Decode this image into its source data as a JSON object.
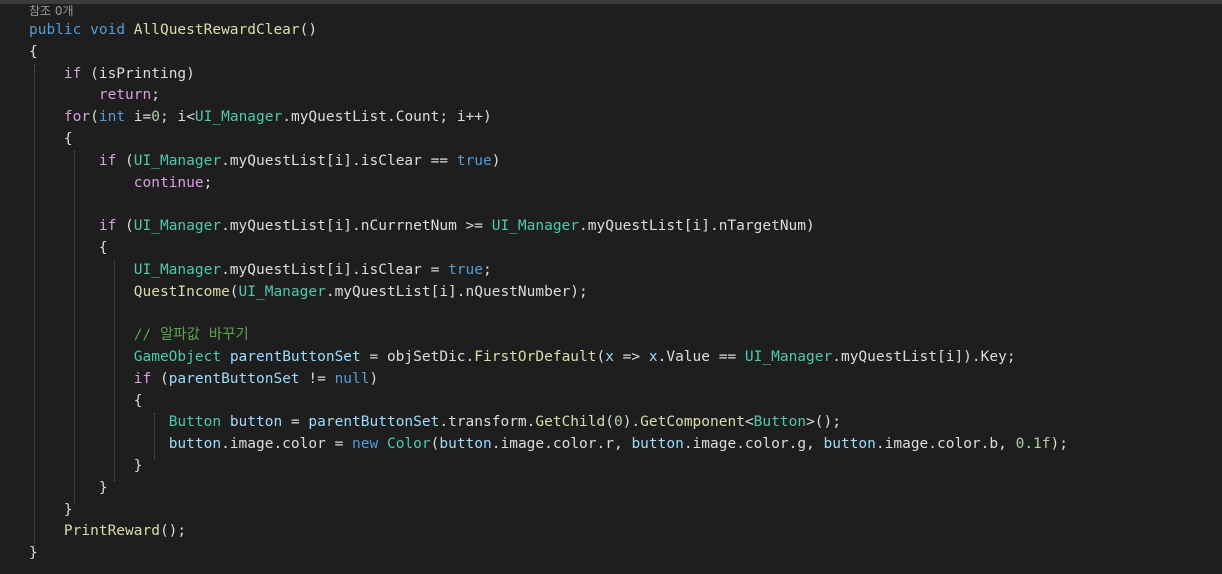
{
  "codelens": {
    "references": "참조 0개"
  },
  "code_lines": [
    [
      {
        "t": "public",
        "c": "kw"
      },
      {
        "t": " ",
        "c": "id"
      },
      {
        "t": "void",
        "c": "kw"
      },
      {
        "t": " ",
        "c": "id"
      },
      {
        "t": "AllQuestRewardClear",
        "c": "fn"
      },
      {
        "t": "()",
        "c": "id"
      }
    ],
    [
      {
        "t": "{",
        "c": "id"
      }
    ],
    [
      {
        "t": "    ",
        "c": "id"
      },
      {
        "t": "if",
        "c": "ctl"
      },
      {
        "t": " (isPrinting)",
        "c": "id"
      }
    ],
    [
      {
        "t": "        ",
        "c": "id"
      },
      {
        "t": "return",
        "c": "ctl"
      },
      {
        "t": ";",
        "c": "id"
      }
    ],
    [
      {
        "t": "    ",
        "c": "id"
      },
      {
        "t": "for",
        "c": "ctl"
      },
      {
        "t": "(",
        "c": "id"
      },
      {
        "t": "int",
        "c": "kw"
      },
      {
        "t": " i=",
        "c": "id"
      },
      {
        "t": "0",
        "c": "num"
      },
      {
        "t": "; i<",
        "c": "id"
      },
      {
        "t": "UI_Manager",
        "c": "ty"
      },
      {
        "t": ".myQuestList.Count; i++)",
        "c": "id"
      }
    ],
    [
      {
        "t": "    {",
        "c": "id"
      }
    ],
    [
      {
        "t": "        ",
        "c": "id"
      },
      {
        "t": "if",
        "c": "ctl"
      },
      {
        "t": " (",
        "c": "id"
      },
      {
        "t": "UI_Manager",
        "c": "ty"
      },
      {
        "t": ".myQuestList[i].isClear == ",
        "c": "id"
      },
      {
        "t": "true",
        "c": "kw"
      },
      {
        "t": ")",
        "c": "id"
      }
    ],
    [
      {
        "t": "            ",
        "c": "id"
      },
      {
        "t": "continue",
        "c": "ctl"
      },
      {
        "t": ";",
        "c": "id"
      }
    ],
    [
      {
        "t": "",
        "c": "id"
      }
    ],
    [
      {
        "t": "        ",
        "c": "id"
      },
      {
        "t": "if",
        "c": "ctl"
      },
      {
        "t": " (",
        "c": "id"
      },
      {
        "t": "UI_Manager",
        "c": "ty"
      },
      {
        "t": ".myQuestList[i].nCurrnetNum >= ",
        "c": "id"
      },
      {
        "t": "UI_Manager",
        "c": "ty"
      },
      {
        "t": ".myQuestList[i].nTargetNum)",
        "c": "id"
      }
    ],
    [
      {
        "t": "        {",
        "c": "id"
      }
    ],
    [
      {
        "t": "            ",
        "c": "id"
      },
      {
        "t": "UI_Manager",
        "c": "ty"
      },
      {
        "t": ".myQuestList[i].isClear = ",
        "c": "id"
      },
      {
        "t": "true",
        "c": "kw"
      },
      {
        "t": ";",
        "c": "id"
      }
    ],
    [
      {
        "t": "            ",
        "c": "id"
      },
      {
        "t": "QuestIncome",
        "c": "fn"
      },
      {
        "t": "(",
        "c": "id"
      },
      {
        "t": "UI_Manager",
        "c": "ty"
      },
      {
        "t": ".myQuestList[i].nQuestNumber);",
        "c": "id"
      }
    ],
    [
      {
        "t": "",
        "c": "id"
      }
    ],
    [
      {
        "t": "            ",
        "c": "id"
      },
      {
        "t": "// 알파값 바꾸기",
        "c": "cm"
      }
    ],
    [
      {
        "t": "            ",
        "c": "id"
      },
      {
        "t": "GameObject",
        "c": "ty"
      },
      {
        "t": " ",
        "c": "id"
      },
      {
        "t": "parentButtonSet",
        "c": "pm"
      },
      {
        "t": " = objSetDic.",
        "c": "id"
      },
      {
        "t": "FirstOrDefault",
        "c": "fn"
      },
      {
        "t": "(",
        "c": "id"
      },
      {
        "t": "x",
        "c": "pm"
      },
      {
        "t": " => ",
        "c": "id"
      },
      {
        "t": "x",
        "c": "pm"
      },
      {
        "t": ".Value == ",
        "c": "id"
      },
      {
        "t": "UI_Manager",
        "c": "ty"
      },
      {
        "t": ".myQuestList[i]).Key;",
        "c": "id"
      }
    ],
    [
      {
        "t": "            ",
        "c": "id"
      },
      {
        "t": "if",
        "c": "ctl"
      },
      {
        "t": " (",
        "c": "id"
      },
      {
        "t": "parentButtonSet",
        "c": "pm"
      },
      {
        "t": " != ",
        "c": "id"
      },
      {
        "t": "null",
        "c": "kw"
      },
      {
        "t": ")",
        "c": "id"
      }
    ],
    [
      {
        "t": "            {",
        "c": "id"
      }
    ],
    [
      {
        "t": "                ",
        "c": "id"
      },
      {
        "t": "Button",
        "c": "ty"
      },
      {
        "t": " ",
        "c": "id"
      },
      {
        "t": "button",
        "c": "pm"
      },
      {
        "t": " = ",
        "c": "id"
      },
      {
        "t": "parentButtonSet",
        "c": "pm"
      },
      {
        "t": ".transform.",
        "c": "id"
      },
      {
        "t": "GetChild",
        "c": "fn"
      },
      {
        "t": "(",
        "c": "id"
      },
      {
        "t": "0",
        "c": "num"
      },
      {
        "t": ").",
        "c": "id"
      },
      {
        "t": "GetComponent",
        "c": "fn"
      },
      {
        "t": "<",
        "c": "id"
      },
      {
        "t": "Button",
        "c": "ty"
      },
      {
        "t": ">();",
        "c": "id"
      }
    ],
    [
      {
        "t": "                ",
        "c": "id"
      },
      {
        "t": "button",
        "c": "pm"
      },
      {
        "t": ".image.color = ",
        "c": "id"
      },
      {
        "t": "new",
        "c": "kw"
      },
      {
        "t": " ",
        "c": "id"
      },
      {
        "t": "Color",
        "c": "ty"
      },
      {
        "t": "(",
        "c": "id"
      },
      {
        "t": "button",
        "c": "pm"
      },
      {
        "t": ".image.color.r, ",
        "c": "id"
      },
      {
        "t": "button",
        "c": "pm"
      },
      {
        "t": ".image.color.g, ",
        "c": "id"
      },
      {
        "t": "button",
        "c": "pm"
      },
      {
        "t": ".image.color.b, ",
        "c": "id"
      },
      {
        "t": "0.1f",
        "c": "num"
      },
      {
        "t": ");",
        "c": "id"
      }
    ],
    [
      {
        "t": "            }",
        "c": "id"
      }
    ],
    [
      {
        "t": "        }",
        "c": "id"
      }
    ],
    [
      {
        "t": "    }",
        "c": "id"
      }
    ],
    [
      {
        "t": "    ",
        "c": "id"
      },
      {
        "t": "PrintReward",
        "c": "fn"
      },
      {
        "t": "();",
        "c": "id"
      }
    ],
    [
      {
        "t": "}",
        "c": "id"
      }
    ]
  ]
}
